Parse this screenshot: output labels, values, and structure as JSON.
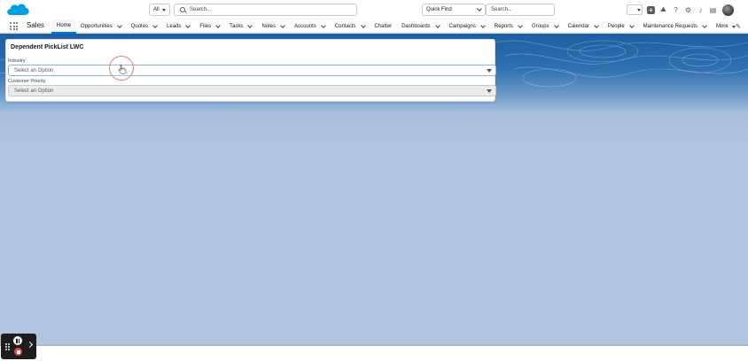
{
  "header": {
    "search_scope": "All",
    "search_placeholder": "Search...",
    "quick_find": "Quick Find",
    "quick_search_placeholder": "Search..."
  },
  "nav": {
    "app_name": "Sales",
    "items": [
      {
        "label": "Home",
        "active": true,
        "has_menu": false
      },
      {
        "label": "Opportunities",
        "has_menu": true
      },
      {
        "label": "Quotes",
        "has_menu": true
      },
      {
        "label": "Leads",
        "has_menu": true
      },
      {
        "label": "Files",
        "has_menu": true
      },
      {
        "label": "Tasks",
        "has_menu": true
      },
      {
        "label": "Notes",
        "has_menu": true
      },
      {
        "label": "Accounts",
        "has_menu": true
      },
      {
        "label": "Contacts",
        "has_menu": true
      },
      {
        "label": "Chatter",
        "has_menu": false
      },
      {
        "label": "Dashboards",
        "has_menu": true
      },
      {
        "label": "Campaigns",
        "has_menu": true
      },
      {
        "label": "Reports",
        "has_menu": true
      },
      {
        "label": "Groups",
        "has_menu": true
      },
      {
        "label": "Calendar",
        "has_menu": true
      },
      {
        "label": "People",
        "has_menu": true
      },
      {
        "label": "Maintenance Requests",
        "has_menu": true
      }
    ],
    "more_label": "More"
  },
  "card": {
    "title": "Dependent PickList LWC",
    "fields": [
      {
        "label": "Industry",
        "value": "Select an Option",
        "disabled": false
      },
      {
        "label": "Customer Priority",
        "value": "Select an Option",
        "disabled": true
      }
    ]
  },
  "colors": {
    "brand_blue": "#0176d3",
    "banner_blue": "#1f5fa0",
    "page_background": "#b0c4df",
    "click_ring": "#e07a86"
  },
  "icons": [
    "salesforce-cloud-logo",
    "search-icon",
    "favorites-star-icon",
    "global-actions-icon",
    "trailhead-icon",
    "help-icon",
    "setup-gear-icon",
    "notifications-bell-icon",
    "assistant-icon",
    "app-launcher-icon",
    "edit-pencil-icon",
    "hand-cursor-icon",
    "pause-icon",
    "stop-icon"
  ]
}
